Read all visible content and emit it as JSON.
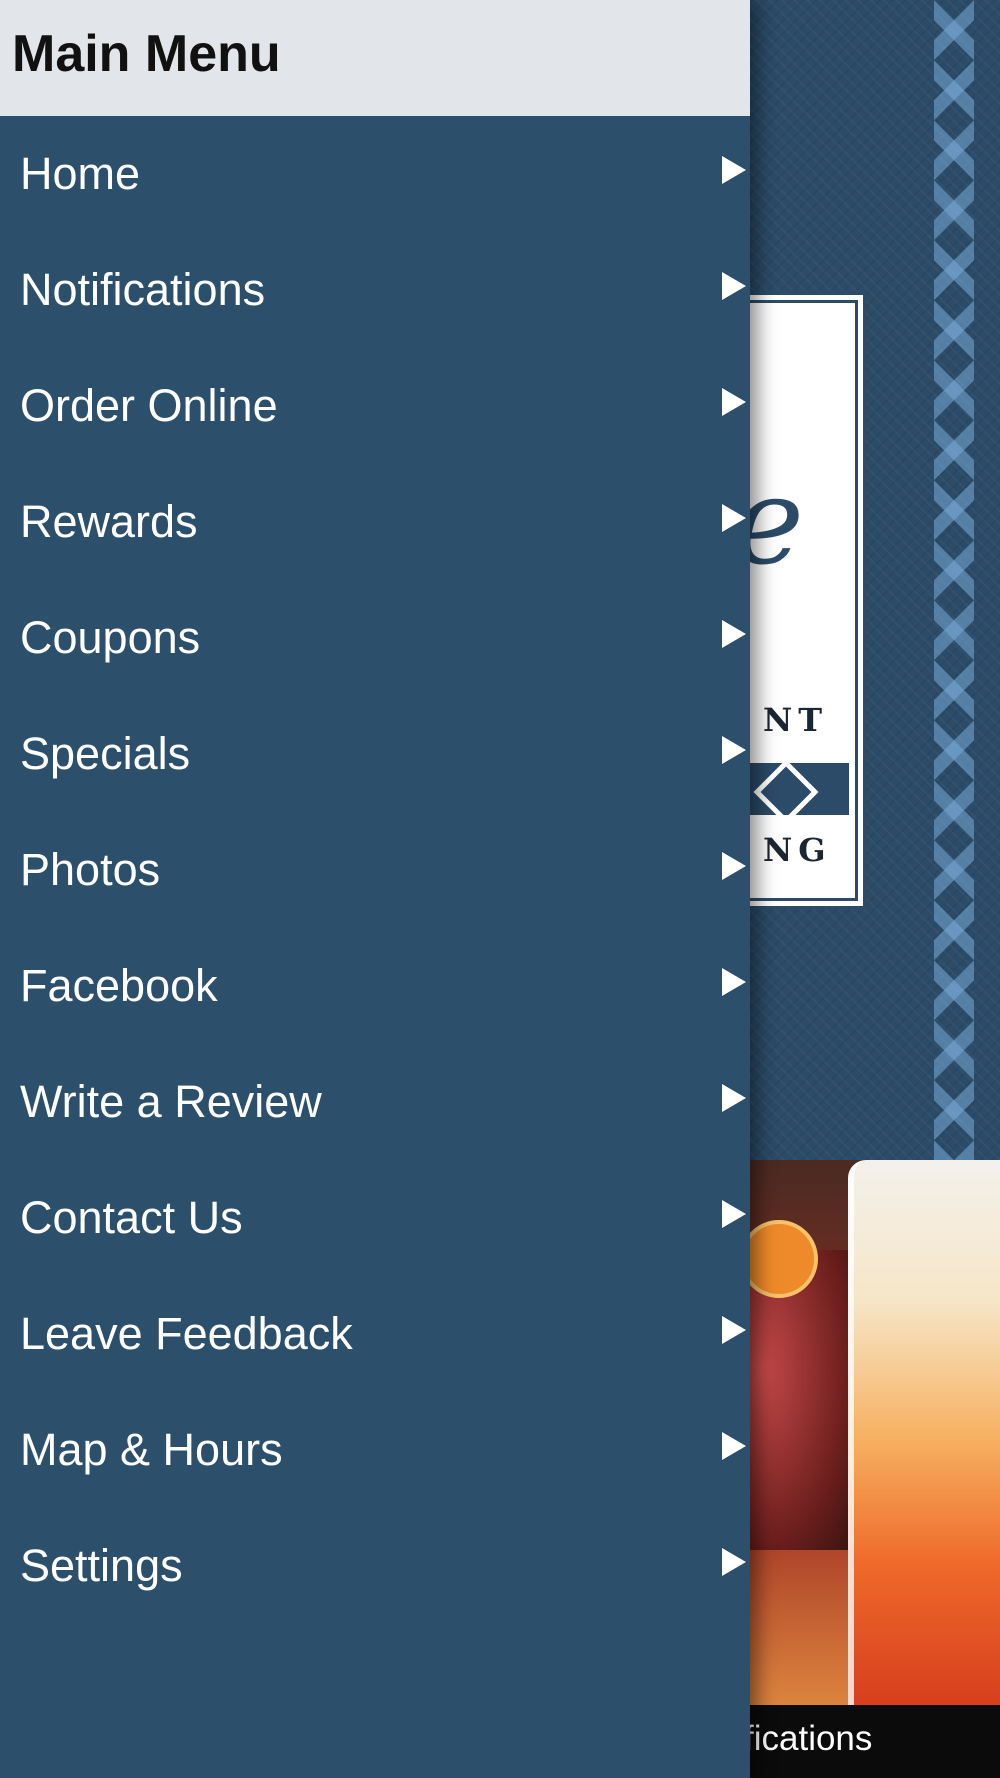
{
  "drawer": {
    "title": "Main Menu",
    "items": [
      {
        "label": "Home",
        "icon": "chevron-right-icon"
      },
      {
        "label": "Notifications",
        "icon": "chevron-right-icon"
      },
      {
        "label": "Order Online",
        "icon": "chevron-right-icon"
      },
      {
        "label": "Rewards",
        "icon": "chevron-right-icon"
      },
      {
        "label": "Coupons",
        "icon": "chevron-right-icon"
      },
      {
        "label": "Specials",
        "icon": "chevron-right-icon"
      },
      {
        "label": "Photos",
        "icon": "chevron-right-icon"
      },
      {
        "label": "Facebook",
        "icon": "chevron-right-icon"
      },
      {
        "label": "Write a Review",
        "icon": "chevron-right-icon"
      },
      {
        "label": "Contact Us",
        "icon": "chevron-right-icon"
      },
      {
        "label": "Leave Feedback",
        "icon": "chevron-right-icon"
      },
      {
        "label": "Map & Hours",
        "icon": "chevron-right-icon"
      },
      {
        "label": "Settings",
        "icon": "chevron-right-icon"
      }
    ]
  },
  "background": {
    "logo_fragments": {
      "script": "e",
      "line1": "NT",
      "line2": "NG"
    },
    "tabbar_peek_text": "fications"
  },
  "colors": {
    "drawer_bg": "#2c4f6c",
    "header_bg": "#e2e6ea",
    "text_light": "#ffffff",
    "text_dark": "#111111"
  }
}
